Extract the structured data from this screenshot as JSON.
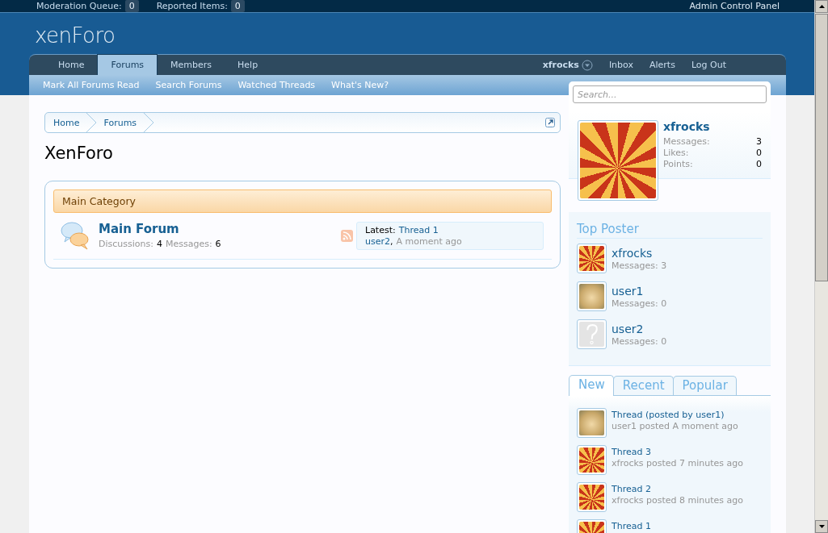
{
  "top_bar": {
    "items": [
      {
        "label": "Moderation Queue:",
        "count": "0"
      },
      {
        "label": "Reported Items:",
        "count": "0"
      }
    ],
    "admin_link": "Admin Control Panel"
  },
  "logo": "xenForo",
  "nav": {
    "tabs": [
      {
        "label": "Home",
        "selected": false
      },
      {
        "label": "Forums",
        "selected": true
      },
      {
        "label": "Members",
        "selected": false
      },
      {
        "label": "Help",
        "selected": false
      }
    ],
    "user": "xfrocks",
    "links": [
      "Inbox",
      "Alerts",
      "Log Out"
    ]
  },
  "subnav": [
    "Mark All Forums Read",
    "Search Forums",
    "Watched Threads",
    "What's New?"
  ],
  "search": {
    "placeholder": "Search..."
  },
  "breadcrumb": [
    "Home",
    "Forums"
  ],
  "title": "XenForo",
  "category": {
    "title": "Main Category",
    "forums": [
      {
        "name": "Main Forum",
        "discussions_label": "Discussions:",
        "discussions": "4",
        "messages_label": "Messages:",
        "messages": "6",
        "latest_label": "Latest:",
        "latest_thread": "Thread 1",
        "latest_user": "user2",
        "latest_sep": ",",
        "latest_time": "A moment ago"
      }
    ]
  },
  "visitor": {
    "name": "xfrocks",
    "avatar": {
      "kind": "cartoon"
    },
    "stats": [
      {
        "label": "Messages:",
        "value": "3"
      },
      {
        "label": "Likes:",
        "value": "0"
      },
      {
        "label": "Points:",
        "value": "0"
      }
    ]
  },
  "top_poster": {
    "title": "Top Poster",
    "users": [
      {
        "name": "xfrocks",
        "avatar": {
          "kind": "cartoon"
        },
        "stat": "Messages: 3"
      },
      {
        "name": "user1",
        "avatar": {
          "kind": "photo"
        },
        "stat": "Messages: 0"
      },
      {
        "name": "user2",
        "avatar": {
          "kind": "default"
        },
        "stat": "Messages: 0"
      }
    ]
  },
  "thread_tabs": [
    {
      "label": "New",
      "selected": true
    },
    {
      "label": "Recent",
      "selected": false
    },
    {
      "label": "Popular",
      "selected": false
    }
  ],
  "threads": [
    {
      "title": "Thread (posted by user1)",
      "avatar": {
        "kind": "photo"
      },
      "meta": "user1 posted A moment ago"
    },
    {
      "title": "Thread 3",
      "avatar": {
        "kind": "cartoon"
      },
      "meta": "xfrocks posted 7 minutes ago"
    },
    {
      "title": "Thread 2",
      "avatar": {
        "kind": "cartoon"
      },
      "meta": "xfrocks posted 8 minutes ago"
    },
    {
      "title": "Thread 1",
      "avatar": {
        "kind": "cartoon"
      }
    }
  ]
}
